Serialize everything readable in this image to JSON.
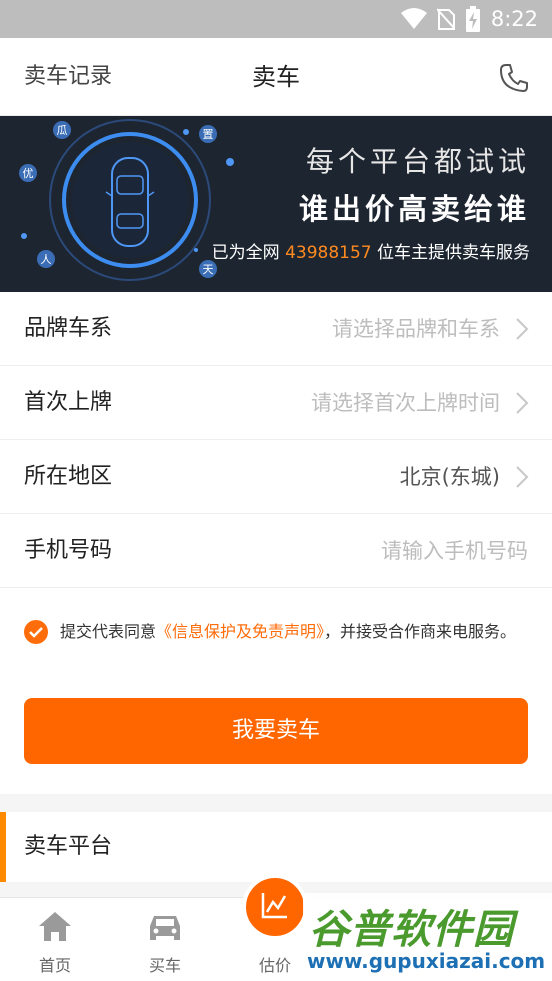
{
  "status_bar": {
    "time": "8:22"
  },
  "header": {
    "left_link": "卖车记录",
    "title": "卖车"
  },
  "banner": {
    "line1": "每个平台都试试",
    "line2": "谁出价高卖给谁",
    "line3_prefix": "已为全网 ",
    "count": "43988157",
    "line3_suffix": " 位车主提供卖车服务",
    "orbit_chars": [
      "瓜",
      "置",
      "优",
      "人",
      "天"
    ]
  },
  "form": {
    "brand": {
      "label": "品牌车系",
      "placeholder": "请选择品牌和车系"
    },
    "first_plate": {
      "label": "首次上牌",
      "placeholder": "请选择首次上牌时间"
    },
    "region": {
      "label": "所在地区",
      "value": "北京(东城)"
    },
    "phone": {
      "label": "手机号码",
      "placeholder": "请输入手机号码"
    }
  },
  "agreement": {
    "prefix": "提交代表同意",
    "link": "《信息保护及免责声明》",
    "suffix": "，并接受合作商来电服务。",
    "checked": true
  },
  "submit_button": "我要卖车",
  "platform_section": {
    "title": "卖车平台"
  },
  "tabbar": {
    "home": "首页",
    "buy": "买车",
    "estimate": "估价"
  },
  "watermark": {
    "name": "谷普软件园",
    "url": "www.gupuxiazai.com"
  },
  "colors": {
    "accent": "#ff6600",
    "banner_bg": "#1d2530",
    "count": "#ff8a1f"
  }
}
